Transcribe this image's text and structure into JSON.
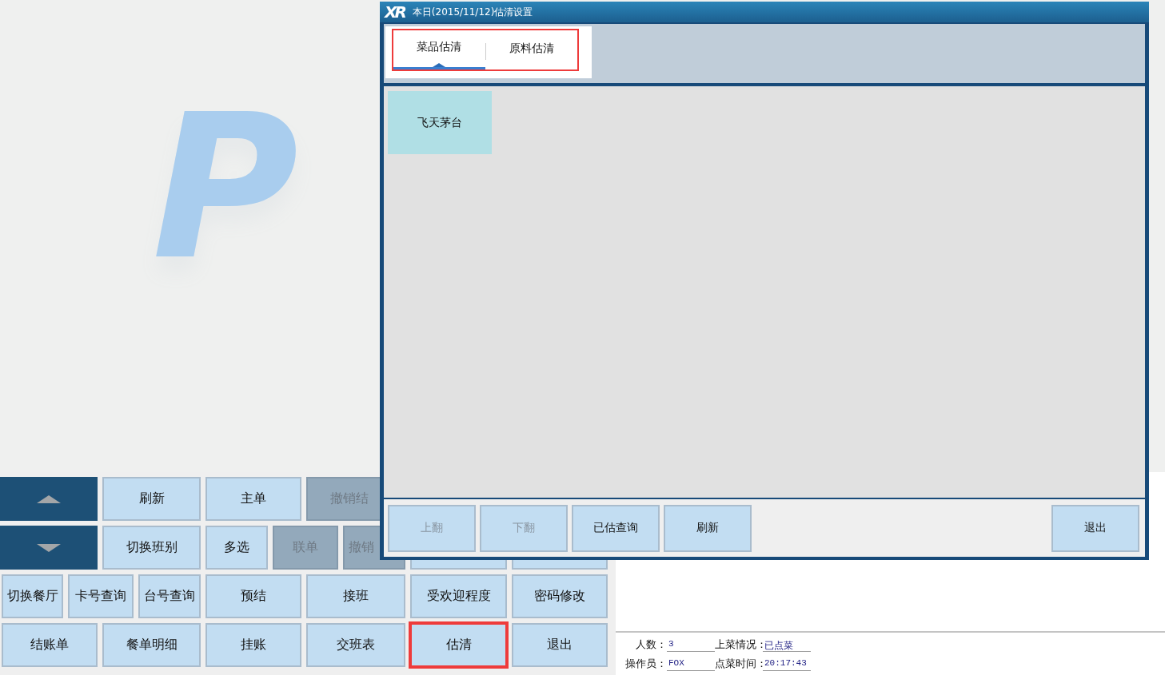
{
  "background_logo": "P",
  "grid": {
    "rows": [
      {
        "items": [
          {
            "kind": "arrow-up"
          },
          {
            "kind": "button",
            "label": "刷新",
            "disabled": false,
            "highlighted": false
          },
          {
            "kind": "button",
            "label": "主单",
            "disabled": false,
            "highlighted": false
          },
          {
            "kind": "button",
            "label": "撤销结",
            "disabled": true,
            "highlighted": false
          }
        ]
      },
      {
        "items": [
          {
            "kind": "arrow-down"
          },
          {
            "kind": "button",
            "label": "切换班别",
            "disabled": false,
            "highlighted": false
          },
          {
            "kind": "button",
            "label": "多选",
            "disabled": false,
            "highlighted": false
          },
          {
            "kind": "button",
            "label": "联单",
            "disabled": true,
            "highlighted": false
          },
          {
            "kind": "button",
            "label": "撤销",
            "disabled": true,
            "highlighted": false
          },
          {
            "kind": "covered"
          },
          {
            "kind": "covered"
          }
        ]
      },
      {
        "items": [
          {
            "kind": "button",
            "label": "切换餐厅",
            "disabled": false,
            "highlighted": false
          },
          {
            "kind": "button",
            "label": "卡号查询",
            "disabled": false,
            "highlighted": false
          },
          {
            "kind": "button",
            "label": "台号查询",
            "disabled": false,
            "highlighted": false
          },
          {
            "kind": "button",
            "label": "预结",
            "disabled": false,
            "highlighted": false
          },
          {
            "kind": "button",
            "label": "接班",
            "disabled": false,
            "highlighted": false
          },
          {
            "kind": "button",
            "label": "受欢迎程度",
            "disabled": false,
            "highlighted": false
          },
          {
            "kind": "button",
            "label": "密码修改",
            "disabled": false,
            "highlighted": false
          }
        ]
      },
      {
        "items": [
          {
            "kind": "button",
            "label": "结账单",
            "disabled": false,
            "highlighted": false
          },
          {
            "kind": "button",
            "label": "餐单明细",
            "disabled": false,
            "highlighted": false
          },
          {
            "kind": "button",
            "label": "挂账",
            "disabled": false,
            "highlighted": false
          },
          {
            "kind": "button",
            "label": "交班表",
            "disabled": false,
            "highlighted": false
          },
          {
            "kind": "button",
            "label": "估清",
            "disabled": false,
            "highlighted": true
          },
          {
            "kind": "button",
            "label": "退出",
            "disabled": false,
            "highlighted": false
          }
        ]
      }
    ]
  },
  "status": {
    "fields": [
      {
        "label": "人数：",
        "value": "3"
      },
      {
        "label": "上菜情况：",
        "value": "已点菜"
      },
      {
        "label": "操作员：",
        "value": "FOX"
      },
      {
        "label": "点菜时间：",
        "value": "20:17:43"
      }
    ]
  },
  "dialog": {
    "logo": "XR",
    "title": "本日(2015/11/12)估清设置",
    "tabs_highlighted": true,
    "tabs": [
      {
        "label": "菜品估清",
        "selected": true
      },
      {
        "label": "原料估清",
        "selected": false
      }
    ],
    "items": [
      {
        "label": "飞天茅台"
      }
    ],
    "buttons": [
      {
        "label": "上翻",
        "disabled": true
      },
      {
        "label": "下翻",
        "disabled": true
      },
      {
        "label": "已估查询",
        "disabled": false
      },
      {
        "label": "刷新",
        "disabled": false
      },
      {
        "label": "退出",
        "disabled": false
      }
    ]
  }
}
